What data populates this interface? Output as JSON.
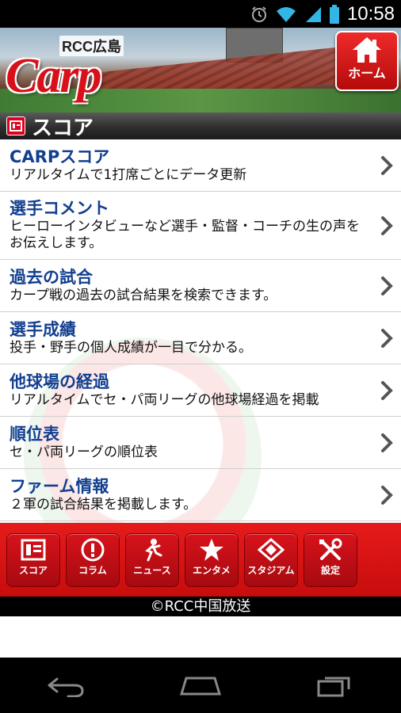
{
  "status_bar": {
    "time": "10:58"
  },
  "header": {
    "logo_top_text": "RCC広島",
    "logo_text": "Carp",
    "home_button_label": "ホーム"
  },
  "section": {
    "title": "スコア"
  },
  "list": [
    {
      "title": "CARPスコア",
      "desc": "リアルタイムで1打席ごとにデータ更新"
    },
    {
      "title": "選手コメント",
      "desc": "ヒーローインタビューなど選手・監督・コーチの生の声をお伝えします。"
    },
    {
      "title": "過去の試合",
      "desc": "カープ戦の過去の試合結果を検索できます。"
    },
    {
      "title": "選手成績",
      "desc": "投手・野手の個人成績が一目で分かる。"
    },
    {
      "title": "他球場の経過",
      "desc": "リアルタイムでセ・パ両リーグの他球場経過を掲載"
    },
    {
      "title": "順位表",
      "desc": "セ・パ両リーグの順位表"
    },
    {
      "title": "ファーム情報",
      "desc": "２軍の試合結果を掲載します。"
    }
  ],
  "tabs": [
    {
      "label": "スコア",
      "icon": "scoreboard-icon"
    },
    {
      "label": "コラム",
      "icon": "exclamation-icon"
    },
    {
      "label": "ニュース",
      "icon": "runner-icon"
    },
    {
      "label": "エンタメ",
      "icon": "star-icon"
    },
    {
      "label": "スタジアム",
      "icon": "stadium-icon"
    },
    {
      "label": "設定",
      "icon": "tools-icon"
    }
  ],
  "footer": {
    "copyright": "©RCC中国放送"
  },
  "colors": {
    "brand_red": "#d8101a",
    "link_blue": "#123f90",
    "list_border": "#cfcfcf"
  }
}
